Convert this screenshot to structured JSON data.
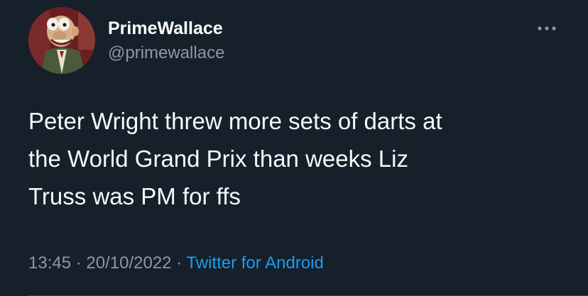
{
  "user": {
    "display_name": "PrimeWallace",
    "handle": "@primewallace",
    "avatar_icon": "claymation-character-avatar"
  },
  "tweet": {
    "lines": [
      "Peter Wright threw more sets of darts at",
      "the World Grand Prix than weeks Liz",
      "Truss was PM for ffs"
    ]
  },
  "meta": {
    "time": "13:45",
    "separator": " · ",
    "date": "20/10/2022",
    "source": "Twitter for Android"
  },
  "icons": {
    "more": "more-options-icon"
  },
  "colors": {
    "background": "#15202b",
    "text": "#f7f9f9",
    "secondary": "#8b98a5",
    "link": "#1d9bf0"
  }
}
